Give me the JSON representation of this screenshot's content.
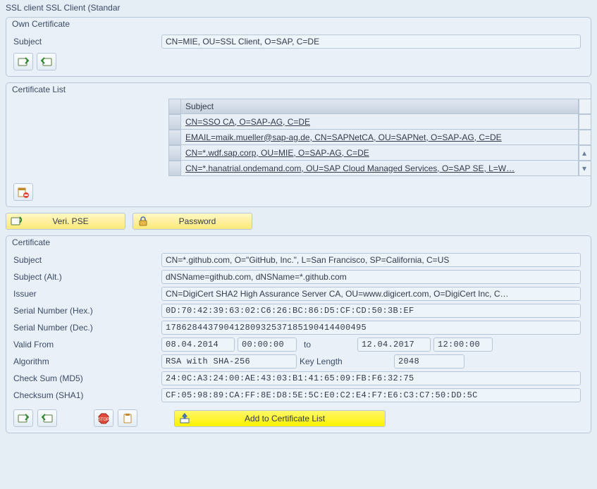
{
  "window_title": "SSL client SSL Client (Standar",
  "own_cert": {
    "title": "Own Certificate",
    "subject_label": "Subject",
    "subject_value": "CN=MIE, OU=SSL Client, O=SAP, C=DE"
  },
  "cert_list": {
    "title": "Certificate List",
    "column_header": "Subject",
    "rows": [
      "CN=SSO CA, O=SAP-AG, C=DE",
      "EMAIL=maik.mueller@sap-ag.de, CN=SAPNetCA, OU=SAPNet, O=SAP-AG, C=DE",
      "CN=*.wdf.sap.corp, OU=MIE, O=SAP-AG, C=DE",
      "CN=*.hanatrial.ondemand.com, OU=SAP Cloud Managed Services, O=SAP SE, L=W…"
    ]
  },
  "toolbar": {
    "veri_pse": "Veri. PSE",
    "password": "Password"
  },
  "certificate": {
    "title": "Certificate",
    "subject_label": "Subject",
    "subject_value": "CN=*.github.com, O=\"GitHub, Inc.\", L=San Francisco, SP=California, C=US",
    "subject_alt_label": "Subject (Alt.)",
    "subject_alt_value": "dNSName=github.com, dNSName=*.github.com",
    "issuer_label": "Issuer",
    "issuer_value": "CN=DigiCert SHA2 High Assurance Server CA, OU=www.digicert.com, O=DigiCert Inc, C…",
    "serial_hex_label": "Serial Number (Hex.)",
    "serial_hex_value": "0D:70:42:39:63:02:C6:26:BC:86:D5:CF:CD:50:3B:EF",
    "serial_dec_label": "Serial Number (Dec.)",
    "serial_dec_value": "17862844379041280932537185190414400495",
    "valid_from_label": "Valid From",
    "valid_from_date": "08.04.2014",
    "valid_from_time": "00:00:00",
    "valid_to_label": "to",
    "valid_to_date": "12.04.2017",
    "valid_to_time": "12:00:00",
    "algorithm_label": "Algorithm",
    "algorithm_value": "RSA with SHA-256",
    "key_length_label": "Key Length",
    "key_length_value": "2048",
    "md5_label": "Check Sum (MD5)",
    "md5_value": "24:0C:A3:24:00:AE:43:03:B1:41:65:09:FB:F6:32:75",
    "sha1_label": "Checksum (SHA1)",
    "sha1_value": "CF:05:98:89:CA:FF:8E:D8:5E:5C:E0:C2:E4:F7:E6:C3:C7:50:DD:5C"
  },
  "actions": {
    "add_to_list": "Add to Certificate List"
  }
}
